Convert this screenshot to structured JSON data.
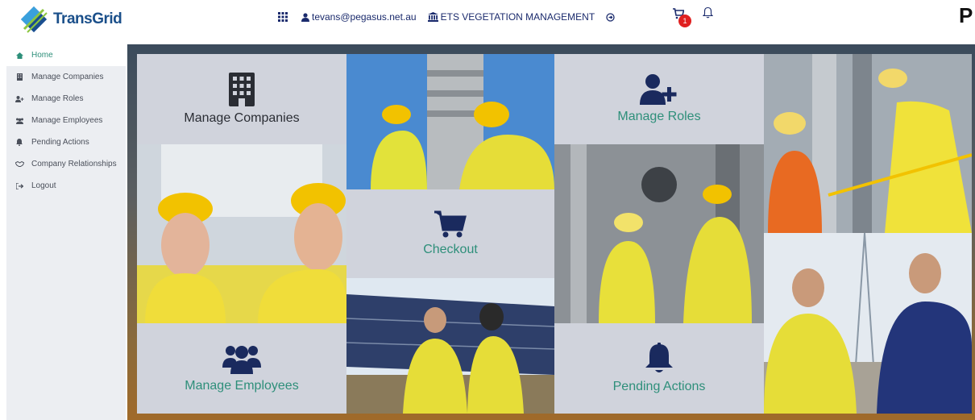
{
  "brand": {
    "name": "TransGrid",
    "corner_letter": "P"
  },
  "topnav": {
    "user_email": "tevans@pegasus.net.au",
    "company": "ETS VEGETATION MANAGEMENT",
    "cart_count": "1"
  },
  "sidebar": {
    "items": [
      {
        "label": "Home",
        "icon": "home-icon"
      },
      {
        "label": "Manage Companies",
        "icon": "building-icon"
      },
      {
        "label": "Manage Roles",
        "icon": "user-plus-icon"
      },
      {
        "label": "Manage Employees",
        "icon": "users-icon"
      },
      {
        "label": "Pending Actions",
        "icon": "bell-icon"
      },
      {
        "label": "Company Relationships",
        "icon": "handshake-icon"
      },
      {
        "label": "Logout",
        "icon": "sign-out-icon"
      }
    ]
  },
  "tiles": {
    "manage_companies": "Manage Companies",
    "manage_roles": "Manage Roles",
    "checkout": "Checkout",
    "manage_employees": "Manage Employees",
    "pending_actions": "Pending Actions"
  },
  "colors": {
    "teal": "#2e8f7a",
    "navy": "#1a2a6c",
    "tile_bg": "#d0d3dc",
    "sidebar_bg": "#eceef2"
  }
}
